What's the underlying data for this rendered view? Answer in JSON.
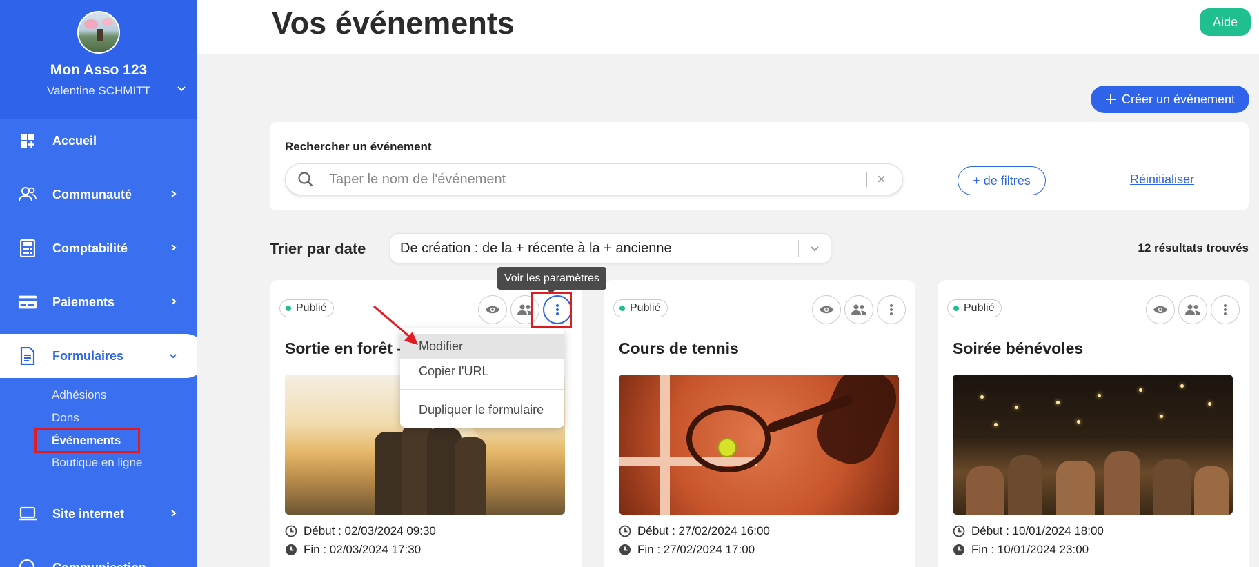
{
  "sidebar": {
    "org_name": "Mon Asso 123",
    "user_name": "Valentine SCHMITT",
    "nav": [
      {
        "label": "Accueil",
        "icon": "dashboard-icon"
      },
      {
        "label": "Communauté",
        "icon": "community-icon"
      },
      {
        "label": "Comptabilité",
        "icon": "calculator-icon"
      },
      {
        "label": "Paiements",
        "icon": "credit-card-icon"
      },
      {
        "label": "Formulaires",
        "icon": "document-icon"
      },
      {
        "label": "Site internet",
        "icon": "laptop-icon"
      },
      {
        "label": "Communication",
        "icon": "megaphone-icon"
      }
    ],
    "sub_items": [
      "Adhésions",
      "Dons",
      "Événements",
      "Boutique en ligne"
    ]
  },
  "header": {
    "title": "Vos événements",
    "help_label": "Aide"
  },
  "toolbar": {
    "create_label": "Créer un événement"
  },
  "search": {
    "label": "Rechercher un événement",
    "placeholder": "Taper le nom de l'événement",
    "value": "",
    "clear": "×",
    "filters_label": "+ de filtres",
    "reset_label": "Réinitialiser"
  },
  "sort": {
    "label": "Trier par date",
    "value": "De création : de la + récente à la + ancienne",
    "results": "12 résultats trouvés"
  },
  "cards": [
    {
      "status": "Publié",
      "title": "Sortie en forêt - ",
      "start": "Début : 02/03/2024 09:30",
      "end": "Fin : 02/03/2024 17:30"
    },
    {
      "status": "Publié",
      "title": "Cours de tennis",
      "start": "Début : 27/02/2024 16:00",
      "end": "Fin : 27/02/2024 17:00"
    },
    {
      "status": "Publié",
      "title": "Soirée bénévoles",
      "start": "Début : 10/01/2024 18:00",
      "end": "Fin : 10/01/2024 23:00"
    }
  ],
  "tooltip": "Voir les paramètres",
  "menu": {
    "items": [
      "Modifier",
      "Copier l'URL",
      "Dupliquer le formulaire"
    ]
  },
  "colors": {
    "primary": "#2e63ea",
    "sidebar": "#3a6ff0",
    "help": "#1fbf8f",
    "annotation": "#e21b22"
  }
}
